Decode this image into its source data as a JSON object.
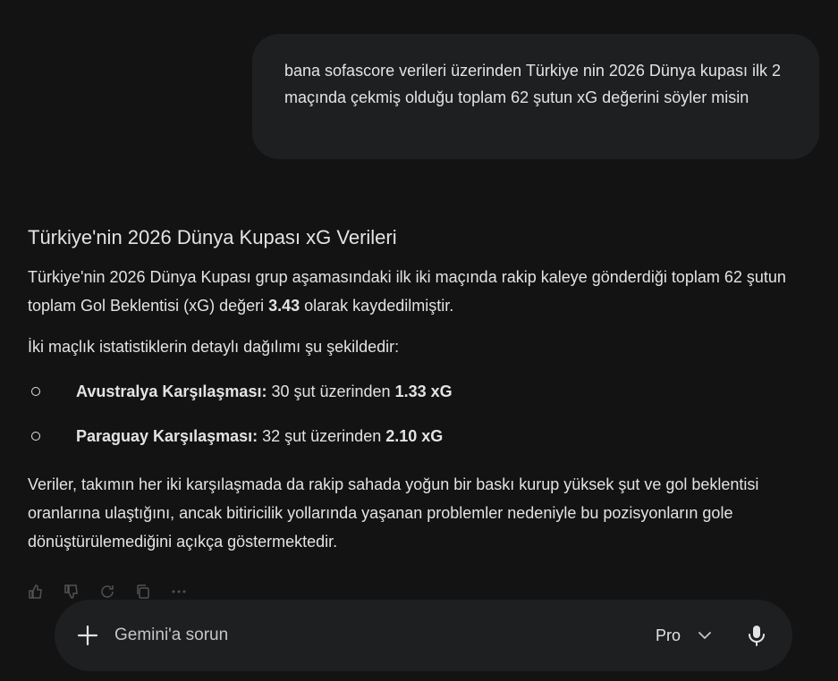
{
  "user_message": {
    "text": "bana sofascore verileri üzerinden Türkiye nin 2026 Dünya kupası ilk 2 maçında çekmiş olduğu toplam 62 şutun xG değerini söyler misin"
  },
  "response": {
    "title": "Türkiye'nin 2026 Dünya Kupası xG Verileri",
    "intro_pre": "Türkiye'nin 2026 Dünya Kupası grup aşamasındaki ilk iki maçında rakip kaleye gönderdiği toplam 62 şutun toplam Gol Beklentisi (xG) değeri ",
    "intro_value": "3.43",
    "intro_post": " olarak kaydedilmiştir.",
    "breakdown_intro": "İki maçlık istatistiklerin detaylı dağılımı şu şekildedir:",
    "matches": [
      {
        "label": "Avustralya Karşılaşması:",
        "detail": " 30 şut üzerinden ",
        "xg": "1.33 xG"
      },
      {
        "label": "Paraguay Karşılaşması:",
        "detail": " 32 şut üzerinden ",
        "xg": "2.10 xG"
      }
    ],
    "conclusion": "Veriler, takımın her iki karşılaşmada da rakip sahada yoğun bir baskı kurup yüksek şut ve gol beklentisi oranlarına ulaştığını, ancak bitiricilik yollarında yaşanan problemler nedeniyle bu pozisyonların gole dönüştürülemediğini açıkça göstermektedir."
  },
  "action_icons": [
    "thumbs-up-icon",
    "thumbs-down-icon",
    "regenerate-icon",
    "copy-icon",
    "more-options-icon"
  ],
  "input": {
    "placeholder": "Gemini'a sorun",
    "mode_label": "Pro"
  },
  "colors": {
    "background": "#131314",
    "surface": "#1e1f20",
    "text": "#e3e3e3",
    "muted_text": "#c4c7c5"
  }
}
